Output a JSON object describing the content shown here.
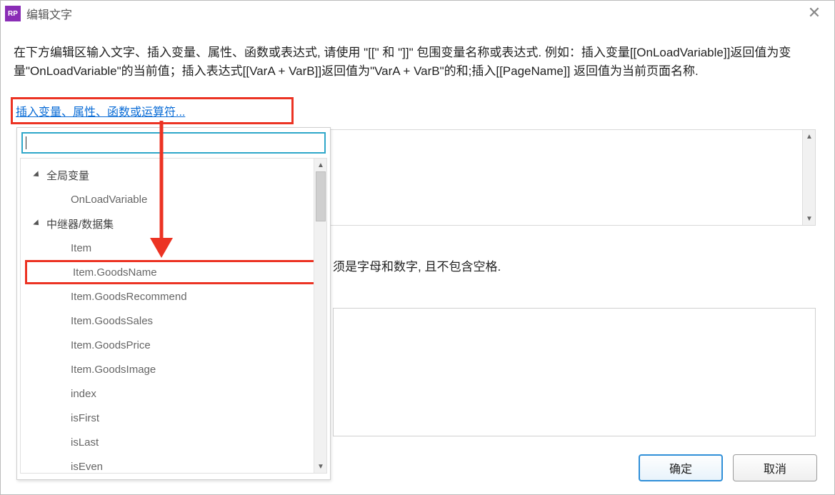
{
  "title": "编辑文字",
  "description": "在下方编辑区输入文字、插入变量、属性、函数或表达式, 请使用 \"[[\" 和 \"]]\" 包围变量名称或表达式. 例如：插入变量[[OnLoadVariable]]返回值为变量\"OnLoadVariable\"的当前值；插入表达式[[VarA + VarB]]返回值为\"VarA + VarB\"的和;插入[[PageName]] 返回值为当前页面名称.",
  "insert_link": "插入变量、属性、函数或运算符...",
  "hint_partial": "须是字母和数字, 且不包含空格.",
  "dropdown": {
    "groups": [
      {
        "label": "全局变量",
        "items": [
          "OnLoadVariable"
        ]
      },
      {
        "label": "中继器/数据集",
        "items": [
          "Item",
          "Item.GoodsName",
          "Item.GoodsRecommend",
          "Item.GoodsSales",
          "Item.GoodsPrice",
          "Item.GoodsImage",
          "index",
          "isFirst",
          "isLast",
          "isEven"
        ]
      }
    ],
    "highlighted": "Item.GoodsName"
  },
  "buttons": {
    "ok": "确定",
    "cancel": "取消"
  },
  "app_icon_text": "RP",
  "scroll": {
    "up": "▲",
    "down": "▼"
  }
}
